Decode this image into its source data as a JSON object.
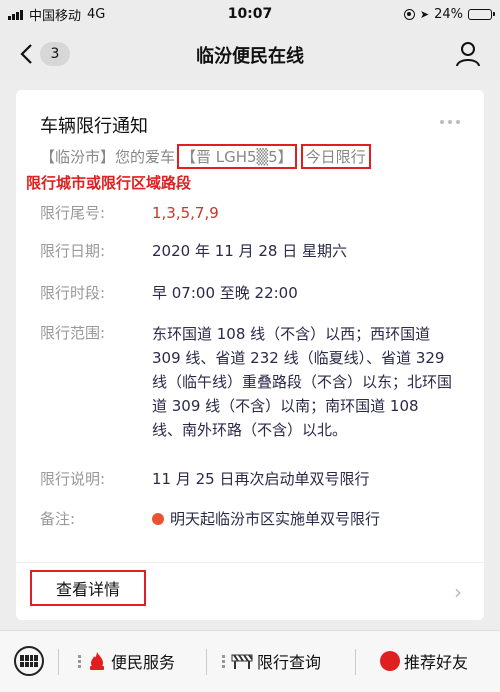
{
  "status_bar": {
    "carrier": "中国移动",
    "network": "4G",
    "time": "10:07",
    "battery": "24%",
    "battery_level": 0.24
  },
  "nav": {
    "badge": "3",
    "title": "临汾便民在线"
  },
  "card": {
    "title": "车辆限行通知",
    "subtitle_prefix": "【临汾市】您的爱车",
    "plate": "【晋 LGH5▒5】",
    "today": "今日限行",
    "annotation": "限行城市或限行区域路段",
    "rows": [
      {
        "label": "限行尾号:",
        "value": "1,3,5,7,9"
      },
      {
        "label": "限行日期:",
        "value": "2020 年 11 月 28 日  星期六"
      },
      {
        "label": "限行时段:",
        "value": "早 07:00 至晚 22:00"
      },
      {
        "label": "限行范围:",
        "value": "东环国道 108 线（不含）以西；西环国道 309 线、省道 232 线（临夏线）、省道 329 线（临午线）重叠路段（不含）以东；北环国道 309 线（不含）以南；南环国道 108 线、南外环路（不含）以北。"
      },
      {
        "label": "限行说明:",
        "value": "11 月 25 日再次启动单双号限行"
      },
      {
        "label": "备注:",
        "value": "明天起临汾市区实施单双号限行"
      }
    ],
    "detail_button": "查看详情"
  },
  "bottom_bar": {
    "tabs": [
      {
        "label": "便民服务"
      },
      {
        "label": "限行查询"
      },
      {
        "label": "推荐好友"
      }
    ]
  },
  "colors": {
    "accent_red": "#e02020",
    "note_orange": "#e8542f"
  }
}
